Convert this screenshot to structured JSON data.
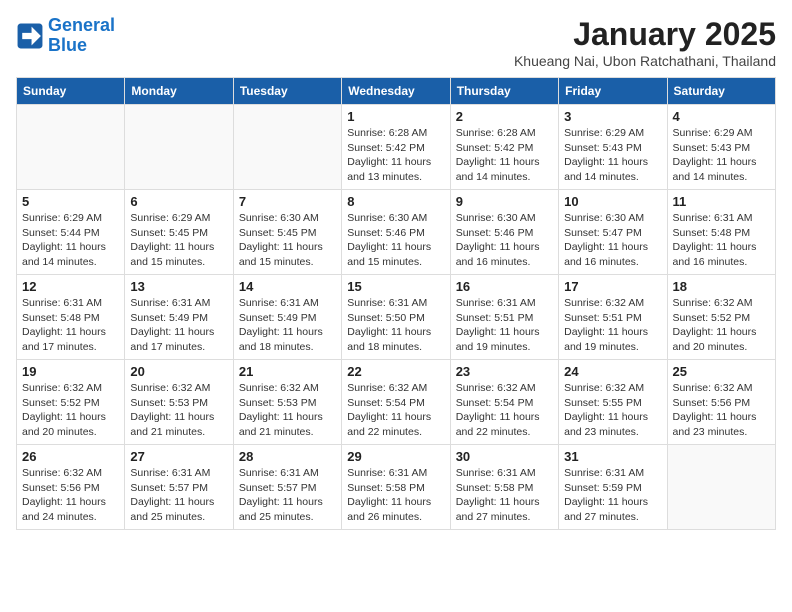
{
  "logo": {
    "line1": "General",
    "line2": "Blue"
  },
  "title": "January 2025",
  "subtitle": "Khueang Nai, Ubon Ratchathani, Thailand",
  "days_header": [
    "Sunday",
    "Monday",
    "Tuesday",
    "Wednesday",
    "Thursday",
    "Friday",
    "Saturday"
  ],
  "weeks": [
    [
      {
        "day": "",
        "info": ""
      },
      {
        "day": "",
        "info": ""
      },
      {
        "day": "",
        "info": ""
      },
      {
        "day": "1",
        "info": "Sunrise: 6:28 AM\nSunset: 5:42 PM\nDaylight: 11 hours\nand 13 minutes."
      },
      {
        "day": "2",
        "info": "Sunrise: 6:28 AM\nSunset: 5:42 PM\nDaylight: 11 hours\nand 14 minutes."
      },
      {
        "day": "3",
        "info": "Sunrise: 6:29 AM\nSunset: 5:43 PM\nDaylight: 11 hours\nand 14 minutes."
      },
      {
        "day": "4",
        "info": "Sunrise: 6:29 AM\nSunset: 5:43 PM\nDaylight: 11 hours\nand 14 minutes."
      }
    ],
    [
      {
        "day": "5",
        "info": "Sunrise: 6:29 AM\nSunset: 5:44 PM\nDaylight: 11 hours\nand 14 minutes."
      },
      {
        "day": "6",
        "info": "Sunrise: 6:29 AM\nSunset: 5:45 PM\nDaylight: 11 hours\nand 15 minutes."
      },
      {
        "day": "7",
        "info": "Sunrise: 6:30 AM\nSunset: 5:45 PM\nDaylight: 11 hours\nand 15 minutes."
      },
      {
        "day": "8",
        "info": "Sunrise: 6:30 AM\nSunset: 5:46 PM\nDaylight: 11 hours\nand 15 minutes."
      },
      {
        "day": "9",
        "info": "Sunrise: 6:30 AM\nSunset: 5:46 PM\nDaylight: 11 hours\nand 16 minutes."
      },
      {
        "day": "10",
        "info": "Sunrise: 6:30 AM\nSunset: 5:47 PM\nDaylight: 11 hours\nand 16 minutes."
      },
      {
        "day": "11",
        "info": "Sunrise: 6:31 AM\nSunset: 5:48 PM\nDaylight: 11 hours\nand 16 minutes."
      }
    ],
    [
      {
        "day": "12",
        "info": "Sunrise: 6:31 AM\nSunset: 5:48 PM\nDaylight: 11 hours\nand 17 minutes."
      },
      {
        "day": "13",
        "info": "Sunrise: 6:31 AM\nSunset: 5:49 PM\nDaylight: 11 hours\nand 17 minutes."
      },
      {
        "day": "14",
        "info": "Sunrise: 6:31 AM\nSunset: 5:49 PM\nDaylight: 11 hours\nand 18 minutes."
      },
      {
        "day": "15",
        "info": "Sunrise: 6:31 AM\nSunset: 5:50 PM\nDaylight: 11 hours\nand 18 minutes."
      },
      {
        "day": "16",
        "info": "Sunrise: 6:31 AM\nSunset: 5:51 PM\nDaylight: 11 hours\nand 19 minutes."
      },
      {
        "day": "17",
        "info": "Sunrise: 6:32 AM\nSunset: 5:51 PM\nDaylight: 11 hours\nand 19 minutes."
      },
      {
        "day": "18",
        "info": "Sunrise: 6:32 AM\nSunset: 5:52 PM\nDaylight: 11 hours\nand 20 minutes."
      }
    ],
    [
      {
        "day": "19",
        "info": "Sunrise: 6:32 AM\nSunset: 5:52 PM\nDaylight: 11 hours\nand 20 minutes."
      },
      {
        "day": "20",
        "info": "Sunrise: 6:32 AM\nSunset: 5:53 PM\nDaylight: 11 hours\nand 21 minutes."
      },
      {
        "day": "21",
        "info": "Sunrise: 6:32 AM\nSunset: 5:53 PM\nDaylight: 11 hours\nand 21 minutes."
      },
      {
        "day": "22",
        "info": "Sunrise: 6:32 AM\nSunset: 5:54 PM\nDaylight: 11 hours\nand 22 minutes."
      },
      {
        "day": "23",
        "info": "Sunrise: 6:32 AM\nSunset: 5:54 PM\nDaylight: 11 hours\nand 22 minutes."
      },
      {
        "day": "24",
        "info": "Sunrise: 6:32 AM\nSunset: 5:55 PM\nDaylight: 11 hours\nand 23 minutes."
      },
      {
        "day": "25",
        "info": "Sunrise: 6:32 AM\nSunset: 5:56 PM\nDaylight: 11 hours\nand 23 minutes."
      }
    ],
    [
      {
        "day": "26",
        "info": "Sunrise: 6:32 AM\nSunset: 5:56 PM\nDaylight: 11 hours\nand 24 minutes."
      },
      {
        "day": "27",
        "info": "Sunrise: 6:31 AM\nSunset: 5:57 PM\nDaylight: 11 hours\nand 25 minutes."
      },
      {
        "day": "28",
        "info": "Sunrise: 6:31 AM\nSunset: 5:57 PM\nDaylight: 11 hours\nand 25 minutes."
      },
      {
        "day": "29",
        "info": "Sunrise: 6:31 AM\nSunset: 5:58 PM\nDaylight: 11 hours\nand 26 minutes."
      },
      {
        "day": "30",
        "info": "Sunrise: 6:31 AM\nSunset: 5:58 PM\nDaylight: 11 hours\nand 27 minutes."
      },
      {
        "day": "31",
        "info": "Sunrise: 6:31 AM\nSunset: 5:59 PM\nDaylight: 11 hours\nand 27 minutes."
      },
      {
        "day": "",
        "info": ""
      }
    ]
  ]
}
